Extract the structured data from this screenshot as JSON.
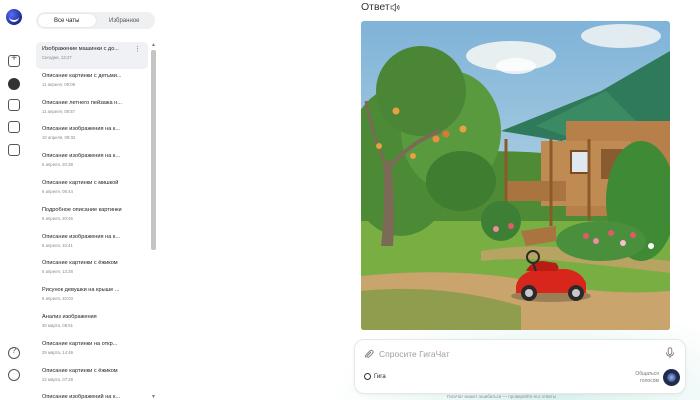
{
  "tabs": {
    "all_chats": "Все чаты",
    "favorites": "Избранное"
  },
  "chats": [
    {
      "title": "Изображение машинки с до...",
      "date": "Сегодня, 13:27",
      "active": true
    },
    {
      "title": "Описание картинки с детьми...",
      "date": "11 апреля, 09:09"
    },
    {
      "title": "Описание летнего пейзажа н...",
      "date": "11 апреля, 08:57"
    },
    {
      "title": "Описание изображения на к...",
      "date": "10 апреля, 08:32"
    },
    {
      "title": "Описание изображения на к...",
      "date": "6 апреля, 20:38"
    },
    {
      "title": "Описание картинки с мишкой",
      "date": "6 апреля, 08:44"
    },
    {
      "title": "Подробное описание картинки",
      "date": "5 апреля, 20:46"
    },
    {
      "title": "Описание изображения на к...",
      "date": "5 апреля, 10:41"
    },
    {
      "title": "Описание картинки с ёжиком",
      "date": "5 апреля, 13:28"
    },
    {
      "title": "Рисунок девушки на крыше ...",
      "date": "5 апреля, 10:03"
    },
    {
      "title": "Анализ изображения",
      "date": "30 марта, 08:51"
    },
    {
      "title": "Описание картинки на откр...",
      "date": "29 марта, 14:46"
    },
    {
      "title": "Описание картинки с ёжиком",
      "date": "22 марта, 07:28"
    },
    {
      "title": "Описание изображений на к...",
      "date": ""
    }
  ],
  "main": {
    "answer_label": "Ответ"
  },
  "input": {
    "placeholder": "Спросите ГигаЧат",
    "model_label": "Гига",
    "voice_label_line1": "Общаться",
    "voice_label_line2": "голосом"
  },
  "disclaimer": "ГигаЧат может ошибаться — проверяйте его ответы",
  "icons": {
    "rail": [
      "new-chat-icon",
      "chats-icon",
      "saved-icon",
      "files-icon",
      "sidebar-toggle-icon",
      "help-icon",
      "profile-icon"
    ]
  },
  "colors": {
    "accent": "#1e2c4f",
    "panel_bg": "#eef0f2",
    "active_item": "#eff1f4"
  }
}
